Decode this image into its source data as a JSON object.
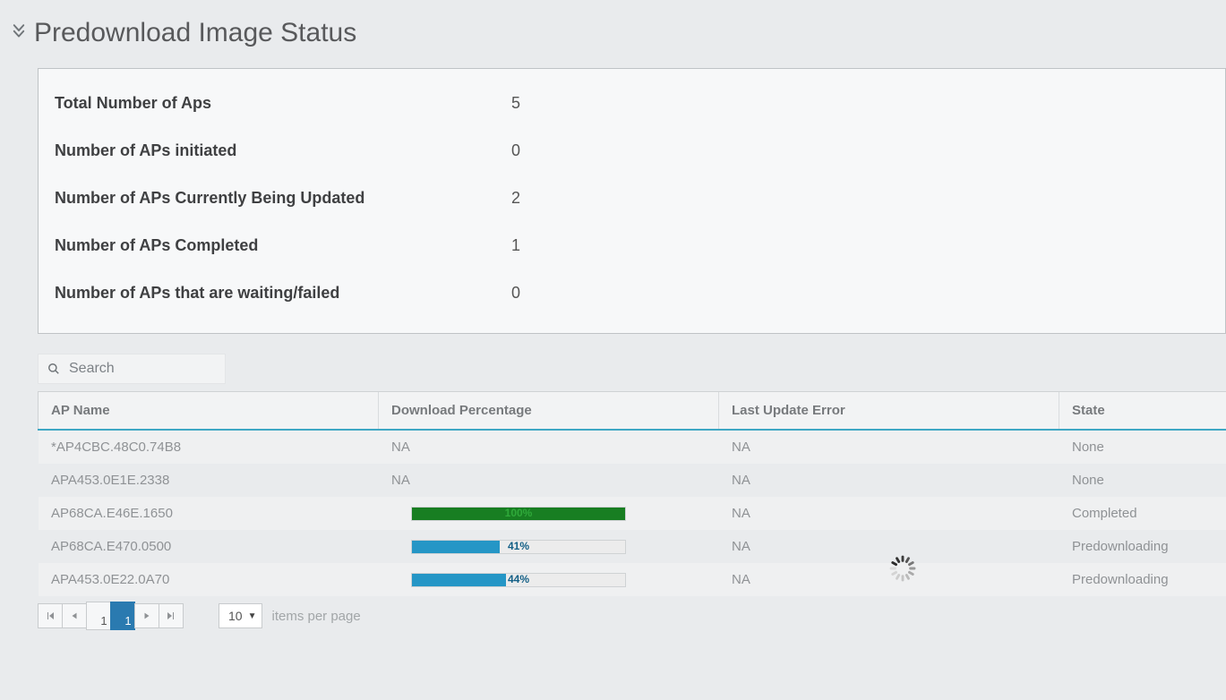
{
  "title": "Predownload Image Status",
  "summary": [
    {
      "label": "Total Number of Aps",
      "value": "5"
    },
    {
      "label": "Number of APs initiated",
      "value": "0"
    },
    {
      "label": "Number of APs Currently Being Updated",
      "value": "2"
    },
    {
      "label": "Number of APs Completed",
      "value": "1"
    },
    {
      "label": "Number of APs that are waiting/failed",
      "value": "0"
    }
  ],
  "search": {
    "placeholder": "Search"
  },
  "columns": {
    "ap_name": "AP Name",
    "download_pct": "Download Percentage",
    "last_error": "Last Update Error",
    "state": "State"
  },
  "rows": [
    {
      "name": "*AP4CBC.48C0.74B8",
      "download": {
        "type": "text",
        "text": "NA"
      },
      "error": "NA",
      "state": "None"
    },
    {
      "name": "APA453.0E1E.2338",
      "download": {
        "type": "text",
        "text": "NA"
      },
      "error": "NA",
      "state": "None"
    },
    {
      "name": "AP68CA.E46E.1650",
      "download": {
        "type": "bar",
        "pct": 100,
        "color": "green",
        "label": "100%"
      },
      "error": "NA",
      "state": "Completed"
    },
    {
      "name": "AP68CA.E470.0500",
      "download": {
        "type": "bar",
        "pct": 41,
        "color": "blue",
        "label": "41%"
      },
      "error": "NA",
      "state": "Predownloading"
    },
    {
      "name": "APA453.0E22.0A70",
      "download": {
        "type": "bar",
        "pct": 44,
        "color": "blue",
        "label": "44%"
      },
      "error": "NA",
      "state": "Predownloading"
    }
  ],
  "pagination": {
    "page_size": "10",
    "items_per_page_label": "items per page",
    "pages": [
      "1",
      "1"
    ],
    "active_index": 1
  }
}
